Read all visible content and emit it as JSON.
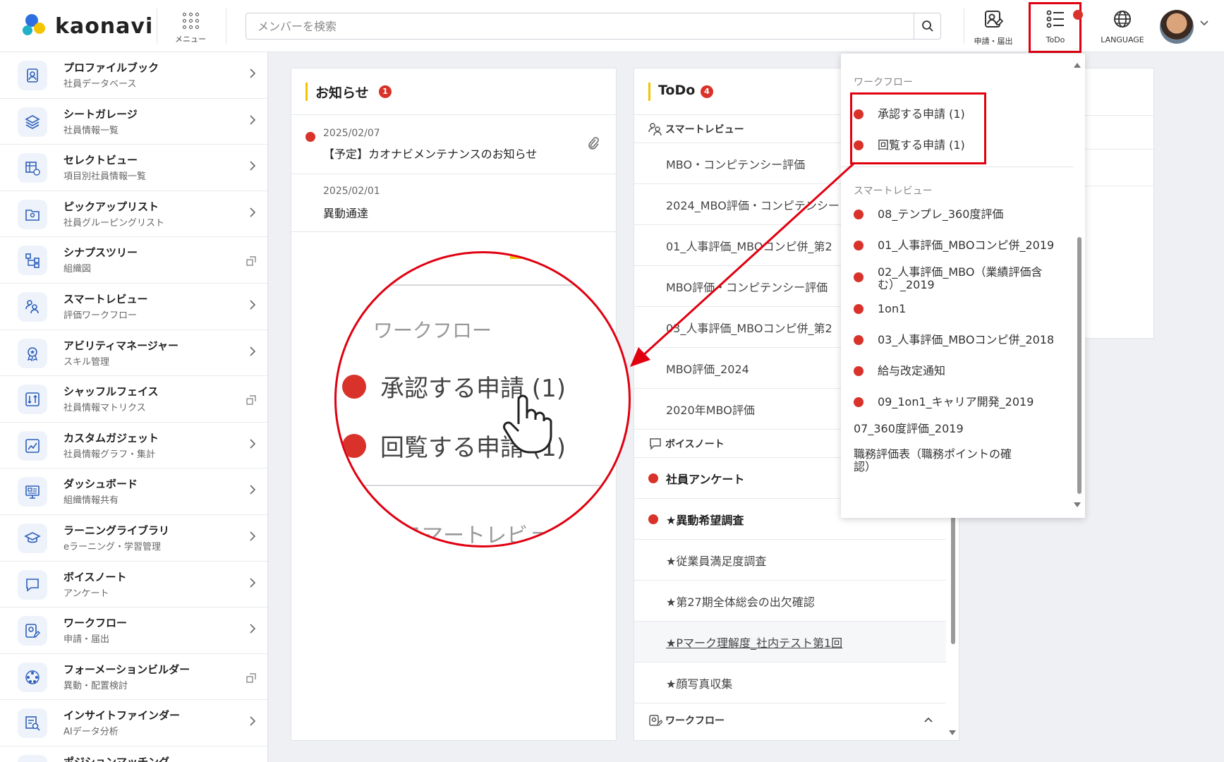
{
  "header": {
    "logo_text": "kaonavi",
    "menu_label": "メニュー",
    "search_placeholder": "メンバーを検索",
    "btn_request_label": "申請・届出",
    "btn_todo_label": "ToDo",
    "btn_language_label": "LANGUAGE"
  },
  "sidebar": {
    "items": [
      {
        "title": "プロファイルブック",
        "sub": "社員データベース",
        "icon": "profile-book-icon",
        "arrow": "chevron"
      },
      {
        "title": "シートガレージ",
        "sub": "社員情報一覧",
        "icon": "layers-icon",
        "arrow": "chevron"
      },
      {
        "title": "セレクトビュー",
        "sub": "項目別社員情報一覧",
        "icon": "table-add-icon",
        "arrow": "chevron"
      },
      {
        "title": "ピックアップリスト",
        "sub": "社員グルーピングリスト",
        "icon": "folder-user-icon",
        "arrow": "chevron"
      },
      {
        "title": "シナプスツリー",
        "sub": "組織図",
        "icon": "org-tree-icon",
        "arrow": "external"
      },
      {
        "title": "スマートレビュー",
        "sub": "評価ワークフロー",
        "icon": "people-review-icon",
        "arrow": "chevron"
      },
      {
        "title": "アビリティマネージャー",
        "sub": "スキル管理",
        "icon": "award-icon",
        "arrow": "chevron"
      },
      {
        "title": "シャッフルフェイス",
        "sub": "社員情報マトリクス",
        "icon": "shuffle-icon",
        "arrow": "external"
      },
      {
        "title": "カスタムガジェット",
        "sub": "社員情報グラフ・集計",
        "icon": "chart-icon",
        "arrow": "chevron"
      },
      {
        "title": "ダッシュボード",
        "sub": "組織情報共有",
        "icon": "dashboard-icon",
        "arrow": "chevron"
      },
      {
        "title": "ラーニングライブラリ",
        "sub": "eラーニング・学習管理",
        "icon": "graduation-cap-icon",
        "arrow": "chevron"
      },
      {
        "title": "ボイスノート",
        "sub": "アンケート",
        "icon": "speech-bubble-icon",
        "arrow": "chevron"
      },
      {
        "title": "ワークフロー",
        "sub": "申請・届出",
        "icon": "workflow-icon",
        "arrow": "chevron"
      },
      {
        "title": "フォーメーションビルダー",
        "sub": "異動・配置検討",
        "icon": "formation-icon",
        "arrow": "external"
      },
      {
        "title": "インサイトファインダー",
        "sub": "AIデータ分析",
        "icon": "insight-icon",
        "arrow": "chevron"
      },
      {
        "title": "ポジションマッチング",
        "sub": "",
        "icon": "position-icon",
        "arrow": "chevron"
      }
    ]
  },
  "news": {
    "title": "お知らせ",
    "count": "1",
    "items": [
      {
        "date": "2025/02/07",
        "title": "【予定】カオナビメンテナンスのお知らせ"
      },
      {
        "date": "2025/02/01",
        "title": "異動通達"
      }
    ]
  },
  "todo": {
    "title": "ToDo",
    "count": "4",
    "section_review": "スマートレビュー",
    "review_items": [
      "MBO・コンピテンシー評価",
      "2024_MBO評価・コンピテンシー",
      "01_人事評価_MBOコンピ併_第2",
      "MBO評価・コンピテンシー評価",
      "03_人事評価_MBOコンピ併_第2",
      "MBO評価_2024",
      "2020年MBO評価"
    ],
    "section_voice": "ボイスノート",
    "voice_items": [
      {
        "text": "社員アンケート",
        "dot": true
      },
      {
        "text": "★異動希望調査",
        "dot": true
      },
      {
        "text": "★従業員満足度調査",
        "dot": false
      },
      {
        "text": "★第27期全体総会の出欠確認",
        "dot": false
      },
      {
        "text": "★Pマーク理解度_社内テスト第1回",
        "dot": false
      },
      {
        "text": "★顔写真収集",
        "dot": false
      }
    ],
    "section_workflow": "ワークフロー"
  },
  "dropdown": {
    "section_workflow": "ワークフロー",
    "workflow_items": [
      "承認する申請 (1)",
      "回覧する申請 (1)"
    ],
    "section_review": "スマートレビュー",
    "review_items": [
      {
        "text": "08_テンプレ_360度評価",
        "dot": true
      },
      {
        "text": "01_人事評価_MBOコンピ併_2019",
        "dot": true
      },
      {
        "text": "02_人事評価_MBO（業績評価含",
        "text2": "む）_2019",
        "dot": true
      },
      {
        "text": "1on1",
        "dot": true
      },
      {
        "text": "03_人事評価_MBOコンピ併_2018",
        "dot": true
      },
      {
        "text": "給与改定通知",
        "dot": true
      },
      {
        "text": "09_1on1_キャリア開発_2019",
        "dot": true
      },
      {
        "text": "07_360度評価_2019",
        "dot": false
      },
      {
        "text": "職務評価表（職務ポイントの確",
        "text2": "認）",
        "dot": false
      }
    ]
  },
  "zoom": {
    "section": "ワークフロー",
    "items": [
      "承認する申請 (1)",
      "回覧する申請 (1)"
    ],
    "section2": "スマートレビュー"
  },
  "colors": {
    "accent_red": "#d8322a",
    "highlight_red": "#e00010",
    "yellow_bar": "#f5c400"
  }
}
